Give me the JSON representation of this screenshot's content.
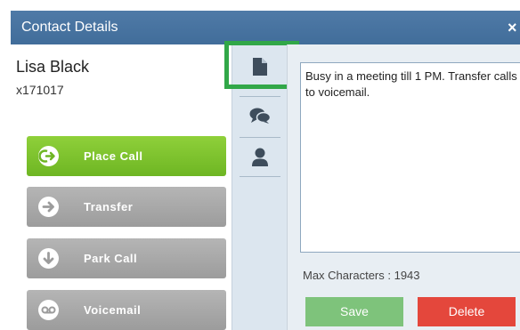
{
  "window": {
    "title": "Contact Details",
    "close_glyph": "×"
  },
  "contact": {
    "name": "Lisa Black",
    "extension": "x171017"
  },
  "actions": [
    {
      "label": "Place Call",
      "icon": "place-call-icon"
    },
    {
      "label": "Transfer",
      "icon": "arrow-right-icon"
    },
    {
      "label": "Park Call",
      "icon": "arrow-down-icon"
    },
    {
      "label": "Voicemail",
      "icon": "voicemail-icon"
    }
  ],
  "tabs": [
    {
      "name": "notes",
      "icon": "document-icon"
    },
    {
      "name": "chat",
      "icon": "chat-bubbles-icon"
    },
    {
      "name": "profile",
      "icon": "person-icon"
    }
  ],
  "note": {
    "text": "Busy in a meeting till 1 PM. Transfer calls to voicemail.",
    "max_characters_text": "Max Characters : 1943"
  },
  "buttons": {
    "save": "Save",
    "delete": "Delete"
  },
  "colors": {
    "title_bar": "#4a75a2",
    "place_call": "#7ec12e",
    "gray_button": "#a8a8a8",
    "save": "#7ec37b",
    "delete": "#e4473c",
    "highlight": "#31a748"
  }
}
